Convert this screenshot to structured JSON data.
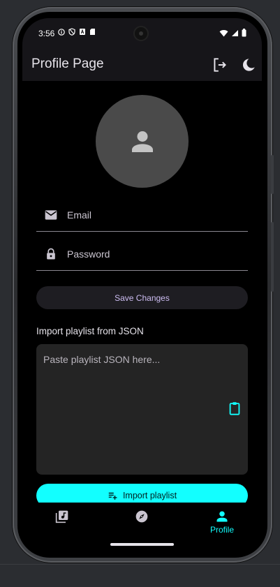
{
  "status_bar": {
    "time": "3:56"
  },
  "app_bar": {
    "title": "Profile Page",
    "logout_icon": "logout-icon",
    "theme_icon": "moon-icon"
  },
  "profile": {
    "avatar_icon": "person-icon",
    "email_placeholder": "Email",
    "email_value": "",
    "password_placeholder": "Password",
    "password_value": "",
    "save_label": "Save Changes"
  },
  "import": {
    "heading": "Import playlist from JSON",
    "json_placeholder": "Paste playlist JSON here...",
    "json_value": "",
    "paste_icon": "clipboard-icon",
    "button_label": "Import playlist",
    "button_icon": "playlist-add-icon"
  },
  "bottom_nav": {
    "items": [
      {
        "icon": "library-music-icon",
        "label": ""
      },
      {
        "icon": "explore-icon",
        "label": ""
      },
      {
        "icon": "person-icon",
        "label": "Profile"
      }
    ]
  },
  "colors": {
    "accent": "#12ffff",
    "primary_text": "#cdbdf2",
    "surface": "#161519",
    "background": "#000000"
  }
}
